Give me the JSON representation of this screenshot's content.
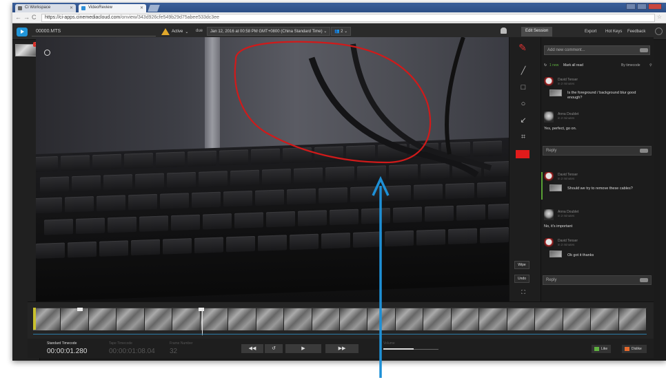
{
  "browser": {
    "tabs": [
      {
        "label": "Ci Workspace",
        "active": false
      },
      {
        "label": "VideoReview",
        "active": true
      }
    ],
    "url_host": "https://ci-apps.cinemediacloud.com",
    "url_path": "/onview/343d926cfe549b29d75abee533dc3ee"
  },
  "header": {
    "filename": "00000.MTS",
    "status_label": "Active",
    "due_label": "due",
    "due_date": "Jan 12, 2016 at 00:58 PM GMT+0800 (China Standard Time)",
    "users_count": "2",
    "edit_session_label": "Edit Session",
    "links": [
      "Export",
      "Hot Keys",
      "Feedback"
    ]
  },
  "sidebar": {
    "thumbnail_badge": "1"
  },
  "tools": {
    "icons": [
      "pencil-icon",
      "line-icon",
      "rectangle-icon",
      "circle-icon",
      "arrow-icon",
      "crop-icon"
    ],
    "active_color": "#e01b1b",
    "wipe_label": "Wipe",
    "undo_label": "Undo"
  },
  "comments": {
    "add_placeholder": "Add new comment...",
    "new_count_label": "1 new",
    "mark_all_read": "Mark all read",
    "sort_label": "By timecode",
    "reply_placeholder": "Reply",
    "threads": [
      {
        "author": "David Tenser",
        "time": "in 2 minutes",
        "text": "Is the foreground / background blur good enough?",
        "replies": [
          {
            "author": "Anna Doublet",
            "time": "in 2 minutes",
            "text": "Yes, perfect, go on."
          }
        ]
      },
      {
        "author": "David Tenser",
        "time": "in 2 minutes",
        "text": "Should we try to remove these cables?",
        "replies": [
          {
            "author": "Anna Doublet",
            "time": "in 2 minutes",
            "text": "No, it's important"
          },
          {
            "author": "David Tenser",
            "time": "in 2 minutes",
            "text": "Ok got it thanks"
          }
        ]
      }
    ]
  },
  "controls": {
    "standard_tc_label": "Standard Timecode",
    "standard_tc": "00:00:01.280",
    "tape_tc_label": "Tape Timecode",
    "tape_tc": "00:00:01:08.04",
    "frame_label": "Frame Number",
    "frame_number": "32",
    "volume_label": "Volume",
    "volume_level": 0.55,
    "like_label": "Like",
    "dislike_label": "Dislike"
  },
  "annotation": {
    "stroke_color": "#d11a1a",
    "arrow_color": "#1e90d6"
  }
}
